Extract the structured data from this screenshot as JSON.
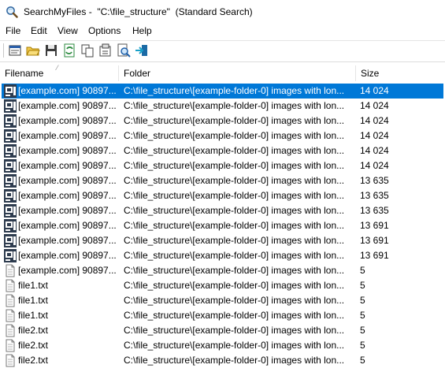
{
  "window": {
    "title": "SearchMyFiles -  \"C:\\file_structure\"  (Standard Search)"
  },
  "menu": [
    "File",
    "Edit",
    "View",
    "Options",
    "Help"
  ],
  "toolbar": {
    "buttons": [
      "properties-icon",
      "open-folder-icon",
      "save-icon",
      "refresh-icon",
      "copy-icon",
      "settings-icon",
      "search-icon",
      "exit-icon"
    ]
  },
  "columns": {
    "filename": "Filename",
    "folder": "Folder",
    "size": "Size"
  },
  "rows": [
    {
      "name": "[example.com] 90897...",
      "folder": "C:\\file_structure\\[example-folder-0] images with lon...",
      "size": "14 024",
      "icon": "image-file-icon",
      "selected": true
    },
    {
      "name": "[example.com] 90897...",
      "folder": "C:\\file_structure\\[example-folder-0] images with lon...",
      "size": "14 024",
      "icon": "image-file-icon"
    },
    {
      "name": "[example.com] 90897...",
      "folder": "C:\\file_structure\\[example-folder-0] images with lon...",
      "size": "14 024",
      "icon": "image-file-icon"
    },
    {
      "name": "[example.com] 90897...",
      "folder": "C:\\file_structure\\[example-folder-0] images with lon...",
      "size": "14 024",
      "icon": "image-file-icon"
    },
    {
      "name": "[example.com] 90897...",
      "folder": "C:\\file_structure\\[example-folder-0] images with lon...",
      "size": "14 024",
      "icon": "image-file-icon"
    },
    {
      "name": "[example.com] 90897...",
      "folder": "C:\\file_structure\\[example-folder-0] images with lon...",
      "size": "14 024",
      "icon": "image-file-icon"
    },
    {
      "name": "[example.com] 90897...",
      "folder": "C:\\file_structure\\[example-folder-0] images with lon...",
      "size": "13 635",
      "icon": "image-file-icon"
    },
    {
      "name": "[example.com] 90897...",
      "folder": "C:\\file_structure\\[example-folder-0] images with lon...",
      "size": "13 635",
      "icon": "image-file-icon"
    },
    {
      "name": "[example.com] 90897...",
      "folder": "C:\\file_structure\\[example-folder-0] images with lon...",
      "size": "13 635",
      "icon": "image-file-icon"
    },
    {
      "name": "[example.com] 90897...",
      "folder": "C:\\file_structure\\[example-folder-0] images with lon...",
      "size": "13 691",
      "icon": "image-file-icon"
    },
    {
      "name": "[example.com] 90897...",
      "folder": "C:\\file_structure\\[example-folder-0] images with lon...",
      "size": "13 691",
      "icon": "image-file-icon"
    },
    {
      "name": "[example.com] 90897...",
      "folder": "C:\\file_structure\\[example-folder-0] images with lon...",
      "size": "13 691",
      "icon": "image-file-icon"
    },
    {
      "name": "[example.com] 90897...",
      "folder": "C:\\file_structure\\[example-folder-0] images with lon...",
      "size": "5",
      "icon": "text-file-icon"
    },
    {
      "name": "file1.txt",
      "folder": "C:\\file_structure\\[example-folder-0] images with lon...",
      "size": "5",
      "icon": "text-file-icon"
    },
    {
      "name": "file1.txt",
      "folder": "C:\\file_structure\\[example-folder-0] images with lon...",
      "size": "5",
      "icon": "text-file-icon"
    },
    {
      "name": "file1.txt",
      "folder": "C:\\file_structure\\[example-folder-0] images with lon...",
      "size": "5",
      "icon": "text-file-icon"
    },
    {
      "name": "file2.txt",
      "folder": "C:\\file_structure\\[example-folder-0] images with lon...",
      "size": "5",
      "icon": "text-file-icon"
    },
    {
      "name": "file2.txt",
      "folder": "C:\\file_structure\\[example-folder-0] images with lon...",
      "size": "5",
      "icon": "text-file-icon"
    },
    {
      "name": "file2.txt",
      "folder": "C:\\file_structure\\[example-folder-0] images with lon...",
      "size": "5",
      "icon": "text-file-icon"
    }
  ],
  "colors": {
    "selection": "#0078d7",
    "selection_text": "#ffffff"
  }
}
